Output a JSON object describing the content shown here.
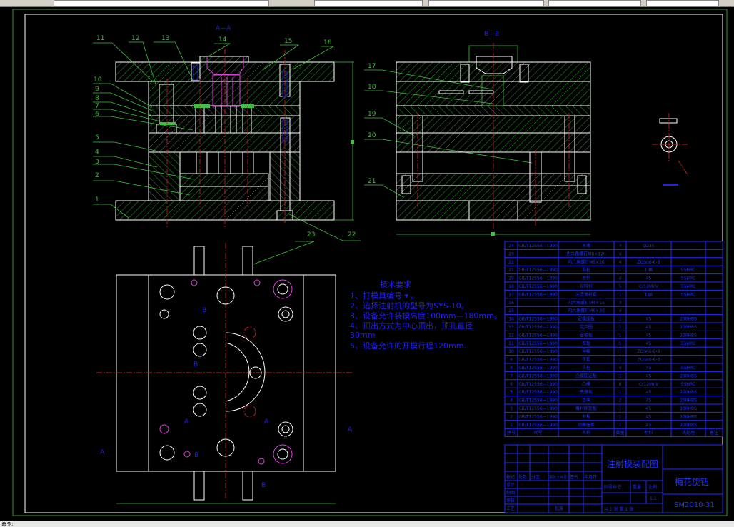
{
  "command_line": {
    "prompt": "命令:"
  },
  "drawing": {
    "section_a": "A—A",
    "section_b": "B—B",
    "view_marks": {
      "a": "A",
      "b": "B"
    },
    "part_labels": [
      "1",
      "2",
      "3",
      "4",
      "5",
      "6",
      "7",
      "8",
      "9",
      "10",
      "11",
      "12",
      "13",
      "14",
      "15",
      "16",
      "17",
      "18",
      "19",
      "20",
      "21",
      "22",
      "23"
    ],
    "colors": {
      "background": "#000000",
      "outline": "#ffffff",
      "hatch": "#3fbf3f",
      "centerline": "#c02020",
      "text": "#2020f0",
      "frame": "#3fbf3f",
      "highlight": "#e040e0"
    }
  },
  "tech_requirements": {
    "title": "技术要求",
    "lines": [
      "1、打模具编号 ▾ 。",
      "2、选择注射机的型号为SYS-10。",
      "3、设备允许装模高度100mm—180mm。",
      "4、顶出方式为中心顶出，顶孔直径",
      "30mm",
      "5、设备允许的开模行程120mm."
    ]
  },
  "parts_table": {
    "headers": [
      "序号",
      "代号",
      "名称",
      "数量",
      "材料",
      "热处理",
      "备注"
    ],
    "rows": [
      [
        "24",
        "GB/T12556—1990",
        "水嘴",
        "4",
        "Q235",
        "",
        ""
      ],
      [
        "23",
        "",
        "内六角螺钉M8×120",
        "4",
        "",
        "",
        ""
      ],
      [
        "22",
        "",
        "内六角螺钉M5×20",
        "4",
        "ZQSn6-6-3",
        "",
        ""
      ],
      [
        "21",
        "GB/T12556—1990",
        "导柱",
        "1",
        "T8A",
        "55HRC",
        ""
      ],
      [
        "19",
        "GB/T12556—1990",
        "推杆",
        "4",
        "45",
        "55HRC",
        ""
      ],
      [
        "18",
        "GB/T12556—1990",
        "拉料杆",
        "5",
        "Cr12MoV",
        "55HRC",
        ""
      ],
      [
        "17",
        "GB/T12556—1990",
        "主浇道衬套",
        "1",
        "T8A",
        "55HRC",
        ""
      ],
      [
        "16",
        "",
        "内六角螺钉M4×15",
        "4",
        "",
        "",
        ""
      ],
      [
        "15",
        "",
        "内六角螺钉M6×30",
        "4",
        "",
        "",
        ""
      ],
      [
        "14",
        "GB/T12556—1990",
        "定模座板",
        "1",
        "45",
        "200HBS",
        ""
      ],
      [
        "13",
        "GB/T12556—1990",
        "定位圈",
        "1",
        "45",
        "200HBS",
        ""
      ],
      [
        "12",
        "GB/T12556—1990",
        "定模板",
        "1",
        "45",
        "200HBS",
        ""
      ],
      [
        "11",
        "GB/T12556—1990",
        "推板",
        "1",
        "45",
        "55HRC",
        ""
      ],
      [
        "10",
        "GB/T12556—1990",
        "导套",
        "1",
        "ZQSn6-6-3",
        "",
        ""
      ],
      [
        "9",
        "GB/T12556—1990",
        "导套",
        "1",
        "ZQSn6-6-3",
        "",
        ""
      ],
      [
        "8",
        "GB/T12556—1990",
        "导柱",
        "4",
        "45",
        "55HRC",
        ""
      ],
      [
        "7",
        "GB/T12556—1990",
        "凸模固定板",
        "1",
        "45",
        "200HBS",
        ""
      ],
      [
        "6",
        "GB/T12556—1990",
        "凸模",
        "8",
        "Cr12MoV",
        "55HRC",
        ""
      ],
      [
        "5",
        "GB/T12556—1990",
        "支撑板",
        "1",
        "45",
        "200HBS",
        ""
      ],
      [
        "4",
        "GB/T12556—1990",
        "垫块",
        "2",
        "45",
        "200HBS",
        ""
      ],
      [
        "3",
        "GB/T12556—1990",
        "推杆固定板",
        "1",
        "45",
        "200HBS",
        ""
      ],
      [
        "2",
        "GB/T12556—1990",
        "推板",
        "1",
        "45",
        "200HBS",
        ""
      ],
      [
        "1",
        "GB/T12556—1990",
        "动模座板",
        "1",
        "45",
        "200HBS",
        ""
      ]
    ]
  },
  "title_block": {
    "drawing_title": "注射模装配图",
    "part_name": "梅花旋钮",
    "drawing_number": "SM2010-31",
    "rev_labels": [
      "标记",
      "处数",
      "分区",
      "更改文件号",
      "签名",
      "年月日"
    ],
    "role_labels": [
      "设计",
      "制图",
      "审核",
      "工艺"
    ],
    "approve_label": "批准",
    "stage_label": "阶段标记",
    "weight_label": "重量",
    "scale_label": "比例",
    "scale": "1:1",
    "sheet_text": "共 1 张 第 1 张"
  }
}
